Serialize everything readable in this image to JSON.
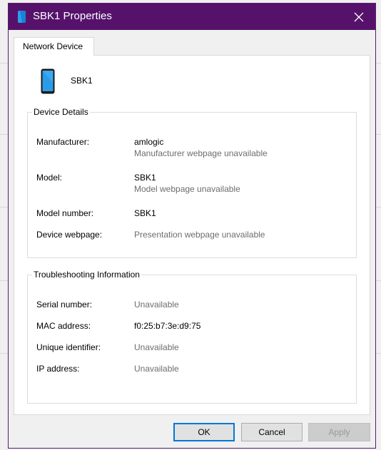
{
  "window": {
    "title": "SBK1 Properties",
    "accent_color": "#56126b"
  },
  "tabs": [
    {
      "label": "Network Device",
      "selected": true
    }
  ],
  "device": {
    "name": "SBK1",
    "icon": "phone-icon"
  },
  "device_details": {
    "legend": "Device Details",
    "manufacturer_label": "Manufacturer:",
    "manufacturer_value": "amlogic",
    "manufacturer_sub": "Manufacturer webpage unavailable",
    "model_label": "Model:",
    "model_value": "SBK1",
    "model_sub": "Model webpage unavailable",
    "model_number_label": "Model number:",
    "model_number_value": "SBK1",
    "webpage_label": "Device webpage:",
    "webpage_value": "Presentation webpage unavailable"
  },
  "troubleshooting": {
    "legend": "Troubleshooting Information",
    "serial_label": "Serial number:",
    "serial_value": "Unavailable",
    "mac_label": "MAC address:",
    "mac_value": "f0:25:b7:3e:d9:75",
    "uid_label": "Unique identifier:",
    "uid_value": "Unavailable",
    "ip_label": "IP address:",
    "ip_value": "Unavailable"
  },
  "buttons": {
    "ok": "OK",
    "cancel": "Cancel",
    "apply": "Apply"
  }
}
